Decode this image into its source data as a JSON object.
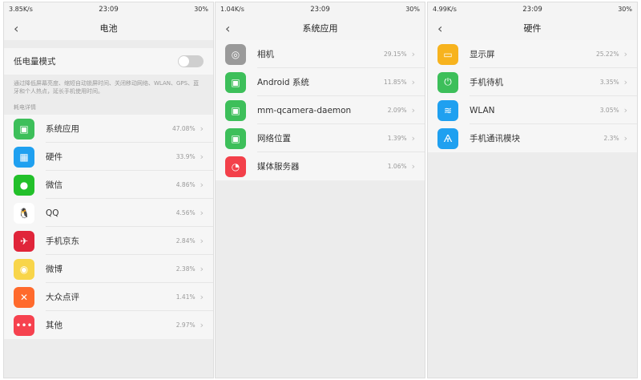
{
  "status": {
    "time": "23:09",
    "battery": "30%"
  },
  "p1": {
    "speed": "3.85K/s",
    "title": "电池",
    "low_power": "低电量模式",
    "desc": "通过降低屏幕亮度、缩短自动锁屏时间、关闭移动网络、WLAN、GPS、蓝牙和个人热点，延长手机使用时间。",
    "section": "耗电详情",
    "items": [
      {
        "label": "系统应用",
        "pct": "47.08%",
        "icon": "android-icon",
        "color": "#3dbf5a",
        "glyph": "▣"
      },
      {
        "label": "硬件",
        "pct": "33.9%",
        "icon": "chip-icon",
        "color": "#1fa0f0",
        "glyph": "▦"
      },
      {
        "label": "微信",
        "pct": "4.86%",
        "icon": "wechat-icon",
        "color": "#22c02a",
        "glyph": "●"
      },
      {
        "label": "QQ",
        "pct": "4.56%",
        "icon": "qq-penguin-icon",
        "color": "#ffffff",
        "glyph": "🐧"
      },
      {
        "label": "手机京东",
        "pct": "2.84%",
        "icon": "jd-icon",
        "color": "#e0253a",
        "glyph": "✈"
      },
      {
        "label": "微博",
        "pct": "2.38%",
        "icon": "weibo-icon",
        "color": "#f8d54a",
        "glyph": "◉"
      },
      {
        "label": "大众点评",
        "pct": "1.41%",
        "icon": "dianping-icon",
        "color": "#ff6a2c",
        "glyph": "✕"
      },
      {
        "label": "其他",
        "pct": "2.97%",
        "icon": "more-icon",
        "color": "#f6424f",
        "glyph": "•••"
      }
    ]
  },
  "p2": {
    "speed": "1.04K/s",
    "title": "系统应用",
    "items": [
      {
        "label": "相机",
        "pct": "29.15%",
        "icon": "camera-icon",
        "color": "#9a9a9a",
        "glyph": "◎"
      },
      {
        "label": "Android 系统",
        "pct": "11.85%",
        "icon": "android-icon",
        "color": "#3dbf5a",
        "glyph": "▣"
      },
      {
        "label": "mm-qcamera-daemon",
        "pct": "2.09%",
        "icon": "android-icon",
        "color": "#3dbf5a",
        "glyph": "▣"
      },
      {
        "label": "网络位置",
        "pct": "1.39%",
        "icon": "android-icon",
        "color": "#3dbf5a",
        "glyph": "▣"
      },
      {
        "label": "媒体服务器",
        "pct": "1.06%",
        "icon": "media-server-icon",
        "color": "#f3404a",
        "glyph": "◔"
      }
    ]
  },
  "p3": {
    "speed": "4.99K/s",
    "title": "硬件",
    "items": [
      {
        "label": "显示屏",
        "pct": "25.22%",
        "icon": "display-icon",
        "color": "#f7b31e",
        "glyph": "▭"
      },
      {
        "label": "手机待机",
        "pct": "3.35%",
        "icon": "power-icon",
        "color": "#3dbf5a",
        "glyph": "⏻"
      },
      {
        "label": "WLAN",
        "pct": "3.05%",
        "icon": "wifi-icon",
        "color": "#1fa0f0",
        "glyph": "≋"
      },
      {
        "label": "手机通讯模块",
        "pct": "2.3%",
        "icon": "antenna-icon",
        "color": "#1fa0f0",
        "glyph": "Ѧ"
      }
    ]
  }
}
